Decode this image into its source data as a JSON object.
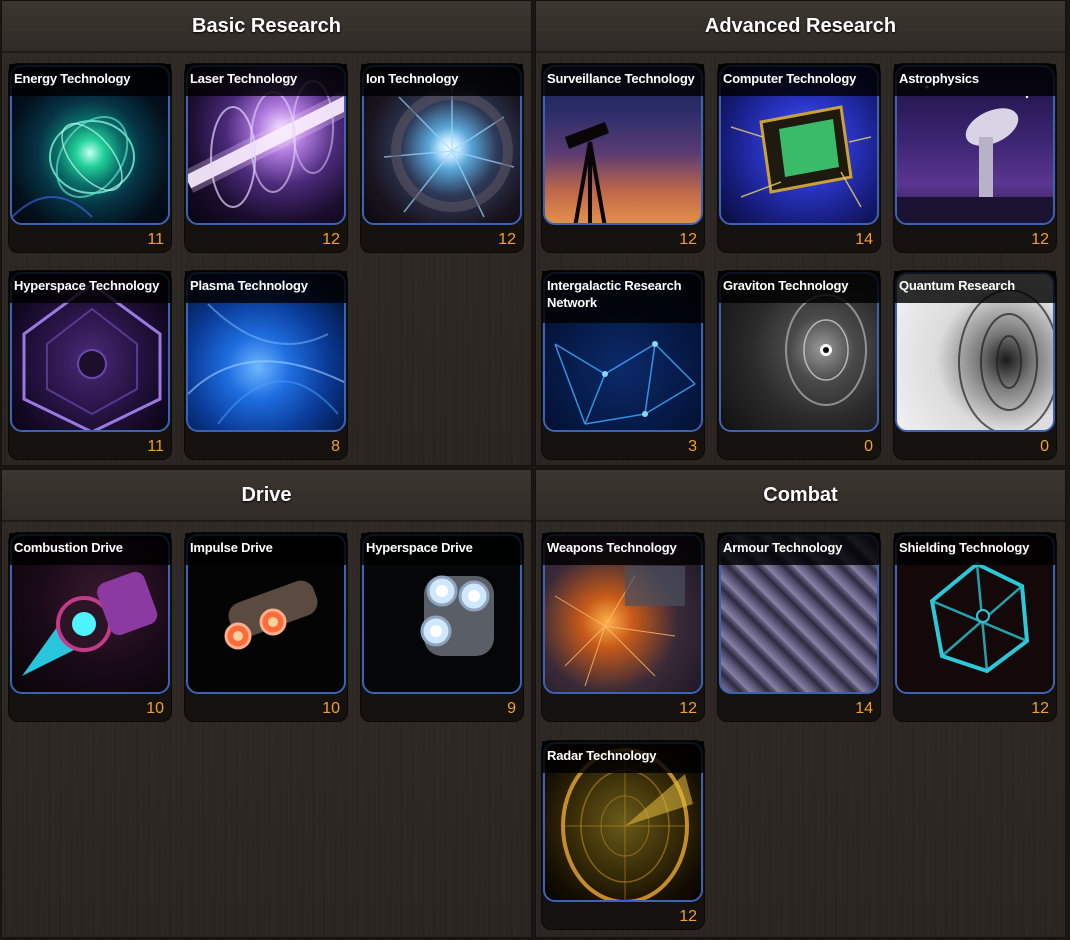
{
  "panels": [
    {
      "title": "Basic Research"
    },
    {
      "title": "Advanced Research"
    },
    {
      "title": "Drive"
    },
    {
      "title": "Combat"
    }
  ],
  "basic": [
    {
      "name": "Energy Technology",
      "level": "11"
    },
    {
      "name": "Laser Technology",
      "level": "12"
    },
    {
      "name": "Ion Technology",
      "level": "12"
    },
    {
      "name": "Hyperspace Technology",
      "level": "11"
    },
    {
      "name": "Plasma Technology",
      "level": "8"
    }
  ],
  "advanced": [
    {
      "name": "Surveillance Technology",
      "level": "12"
    },
    {
      "name": "Computer Technology",
      "level": "14"
    },
    {
      "name": "Astrophysics",
      "level": "12"
    },
    {
      "name": "Intergalactic Research Network",
      "level": "3"
    },
    {
      "name": "Graviton Technology",
      "level": "0"
    },
    {
      "name": "Quantum Research",
      "level": "0"
    }
  ],
  "drive": [
    {
      "name": "Combustion Drive",
      "level": "10"
    },
    {
      "name": "Impulse Drive",
      "level": "10"
    },
    {
      "name": "Hyperspace Drive",
      "level": "9"
    }
  ],
  "combat": [
    {
      "name": "Weapons Technology",
      "level": "12"
    },
    {
      "name": "Armour Technology",
      "level": "14"
    },
    {
      "name": "Shielding Technology",
      "level": "12"
    },
    {
      "name": "Radar Technology",
      "level": "12"
    }
  ],
  "level_color": "#f2a12a",
  "frame_color": "#3c63b3"
}
